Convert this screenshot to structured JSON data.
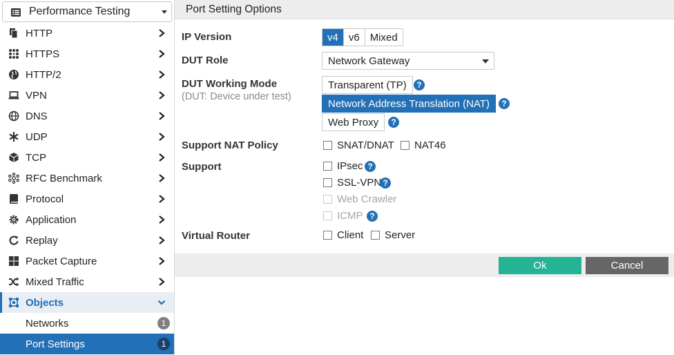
{
  "sidebar": {
    "selector": {
      "label": "Performance Testing",
      "icon": "list-icon"
    },
    "items": [
      {
        "label": "HTTP",
        "icon": "files-icon"
      },
      {
        "label": "HTTPS",
        "icon": "dots-grid-icon"
      },
      {
        "label": "HTTP/2",
        "icon": "globe-icon"
      },
      {
        "label": "VPN",
        "icon": "laptop-icon"
      },
      {
        "label": "DNS",
        "icon": "network-globe-icon"
      },
      {
        "label": "UDP",
        "icon": "asterisk-icon"
      },
      {
        "label": "TCP",
        "icon": "cube-icon"
      },
      {
        "label": "RFC Benchmark",
        "icon": "cluster-icon"
      },
      {
        "label": "Protocol",
        "icon": "book-icon"
      },
      {
        "label": "Application",
        "icon": "gear-icon"
      },
      {
        "label": "Replay",
        "icon": "replay-icon"
      },
      {
        "label": "Packet Capture",
        "icon": "grid-icon"
      },
      {
        "label": "Mixed Traffic",
        "icon": "shuffle-icon"
      },
      {
        "label": "Objects",
        "icon": "objects-icon"
      }
    ],
    "sub_items": [
      {
        "label": "Networks",
        "count": "1"
      },
      {
        "label": "Port Settings",
        "count": "1"
      }
    ]
  },
  "main": {
    "title": "Port Setting Options",
    "ip_version": {
      "label": "IP Version",
      "options": [
        "v4",
        "v6",
        "Mixed"
      ],
      "selected": "v4"
    },
    "dut_role": {
      "label": "DUT Role",
      "value": "Network Gateway"
    },
    "dut_mode": {
      "label": "DUT Working Mode",
      "sublabel": "(DUT: Device under test)",
      "options": [
        "Transparent (TP)",
        "Network Address Translation (NAT)",
        "Web Proxy"
      ],
      "selected": "Network Address Translation (NAT)"
    },
    "nat_policy": {
      "label": "Support NAT Policy",
      "options": [
        "SNAT/DNAT",
        "NAT46"
      ]
    },
    "support": {
      "label": "Support",
      "options": [
        "IPsec",
        "SSL-VPN",
        "Web Crawler",
        "ICMP"
      ]
    },
    "virtual_router": {
      "label": "Virtual Router",
      "options": [
        "Client",
        "Server"
      ]
    },
    "help_glyph": "?",
    "buttons": {
      "ok": "Ok",
      "cancel": "Cancel"
    }
  },
  "colors": {
    "accent": "#2270b7",
    "ok": "#24b394",
    "cancel": "#666666",
    "badge": "#808080"
  }
}
